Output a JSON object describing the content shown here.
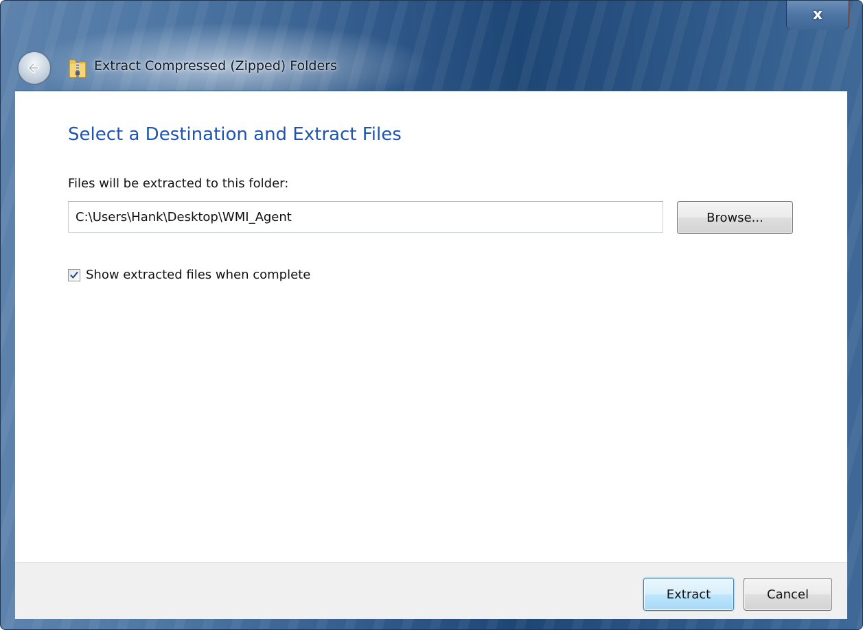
{
  "window": {
    "title": "Extract Compressed (Zipped) Folders",
    "close_symbol": "x"
  },
  "wizard": {
    "heading": "Select a Destination and Extract Files",
    "folder_label": "Files will be extracted to this folder:",
    "destination_path": "C:\\Users\\Hank\\Desktop\\WMI_Agent",
    "browse_label": "Browse...",
    "show_files_label": "Show extracted files when complete",
    "show_files_checked": true
  },
  "footer": {
    "extract_label": "Extract",
    "cancel_label": "Cancel"
  },
  "icons": {
    "back": "back-arrow-icon",
    "folder": "zip-folder-icon",
    "close": "close-icon",
    "check": "check-icon"
  },
  "colors": {
    "heading": "#1e54b0",
    "chrome": "#2f5889",
    "close_button": "#c4402a",
    "default_button": "#3c7fb1"
  }
}
